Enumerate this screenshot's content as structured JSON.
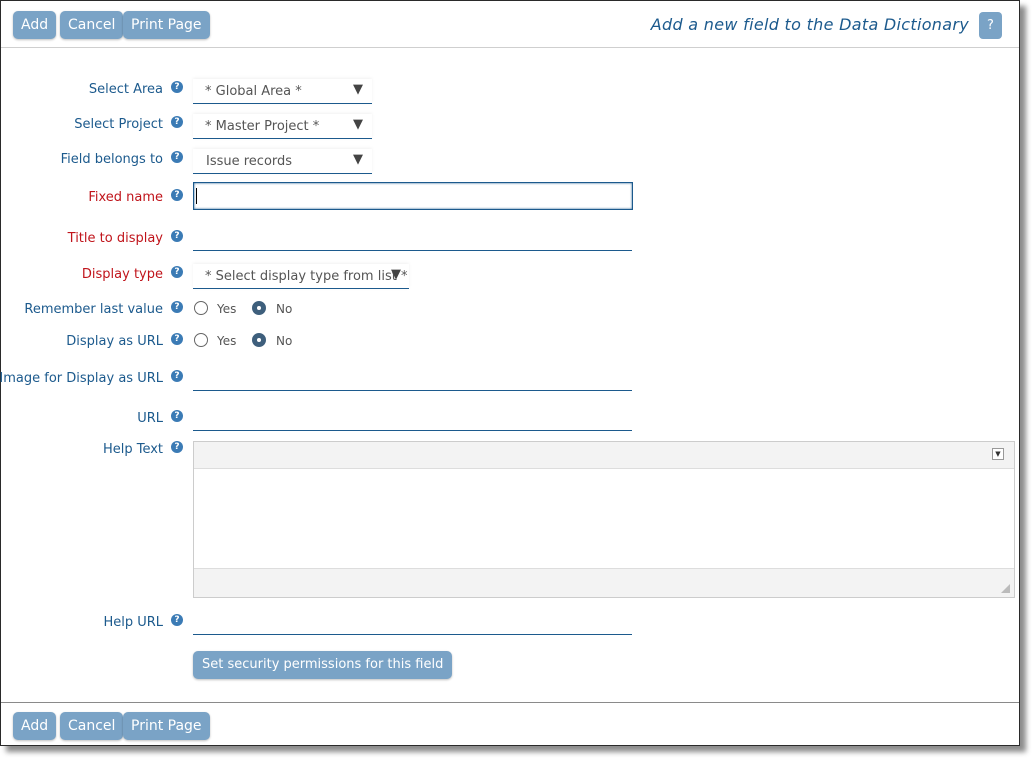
{
  "toolbar": {
    "add_label": "Add",
    "cancel_label": "Cancel",
    "print_label": "Print Page"
  },
  "header": {
    "title": "Add a new field to the Data Dictionary",
    "help_label": "?"
  },
  "help_glyph": "?",
  "form": {
    "select_area": {
      "label": "Select Area",
      "value": "* Global Area *"
    },
    "select_project": {
      "label": "Select Project",
      "value": "* Master Project *"
    },
    "field_belongs_to": {
      "label": "Field belongs to",
      "value": "Issue records"
    },
    "fixed_name": {
      "label": "Fixed name",
      "value": ""
    },
    "title_to_display": {
      "label": "Title to display",
      "value": ""
    },
    "display_type": {
      "label": "Display type",
      "value": "* Select display type from list *"
    },
    "remember_last_value": {
      "label": "Remember last value",
      "yes": "Yes",
      "no": "No",
      "selected": "No"
    },
    "display_as_url": {
      "label": "Display as URL",
      "yes": "Yes",
      "no": "No",
      "selected": "No"
    },
    "image_for_display_as_url": {
      "label": "Image for Display as URL",
      "value": ""
    },
    "url": {
      "label": "URL",
      "value": ""
    },
    "help_text": {
      "label": "Help Text",
      "value": ""
    },
    "help_url": {
      "label": "Help URL",
      "value": ""
    },
    "security_button": "Set security permissions for this field"
  },
  "colors": {
    "accent": "#7aa3c6",
    "label": "#1c5a8d",
    "required": "#c0141b"
  },
  "icons": {
    "help": "question-circle-icon",
    "dropdown": "triangle-down-icon"
  }
}
